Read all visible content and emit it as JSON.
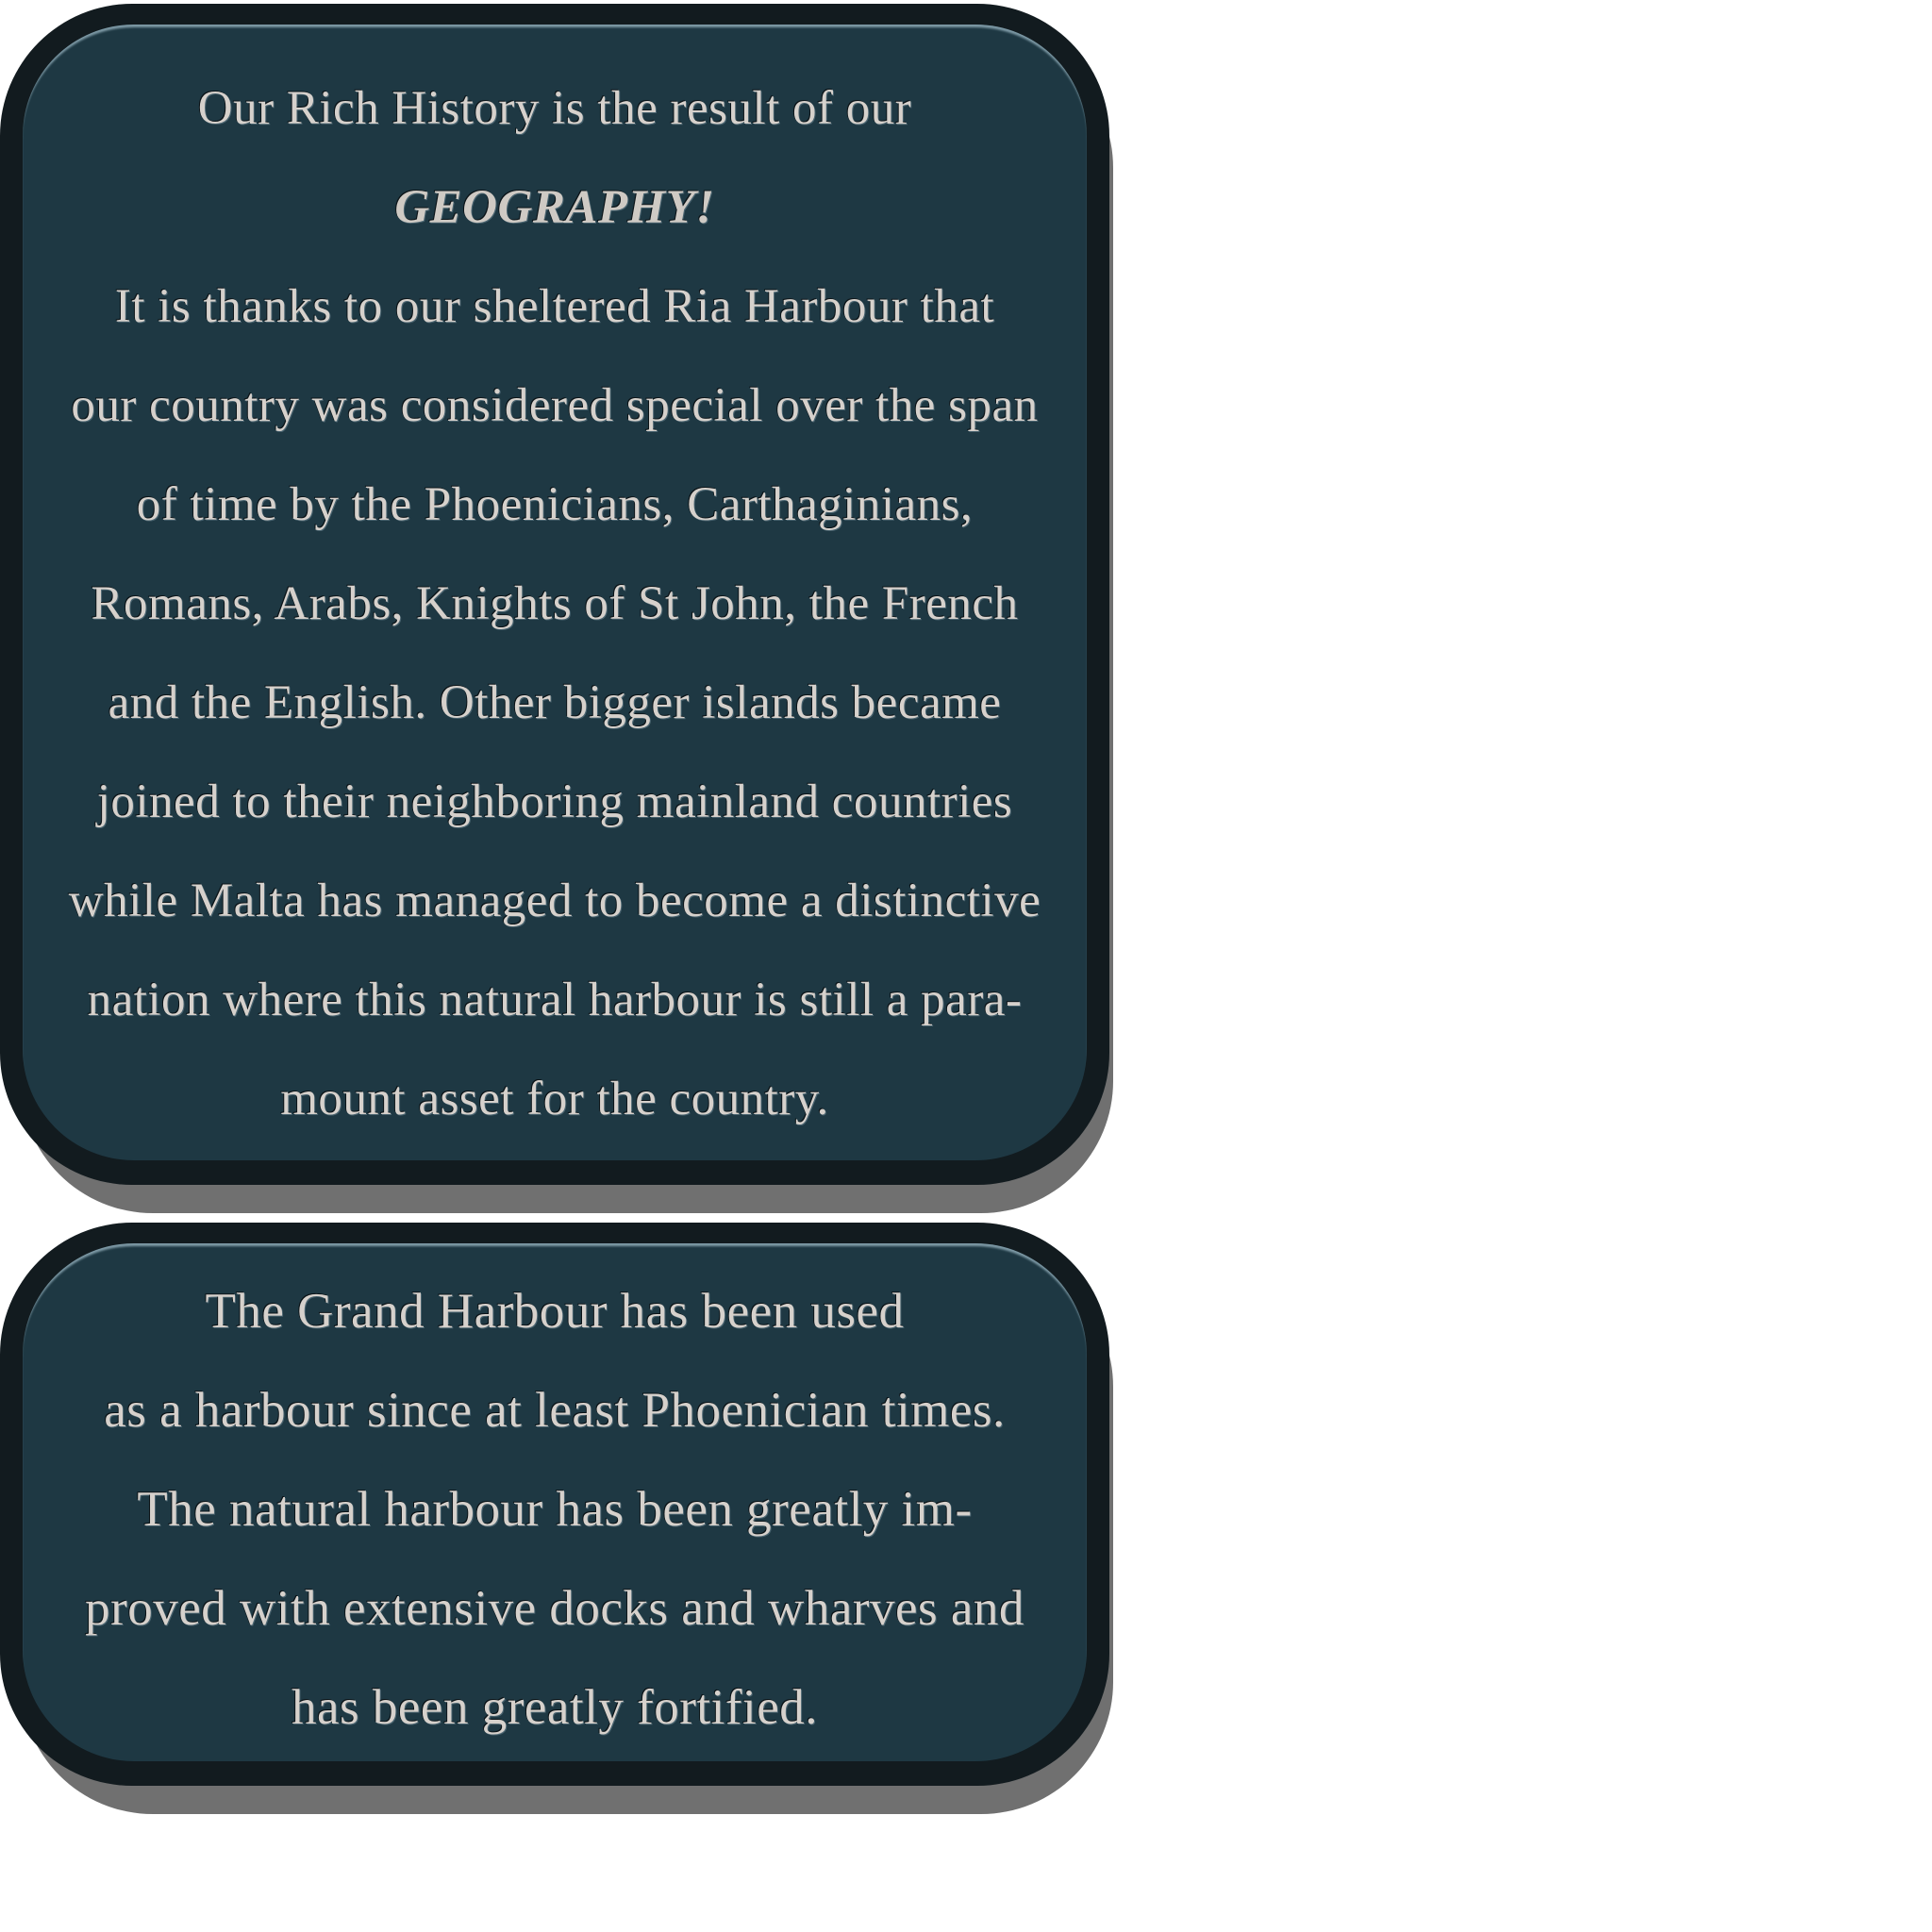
{
  "panel1": {
    "lines": [
      "Our Rich History is the result of  our",
      "GEOGRAPHY!",
      "It is thanks to our sheltered Ria Harbour that",
      "our country was considered special over the span",
      "of  time by the Phoenicians, Carthaginians,",
      "Romans, Arabs, Knights of  St John, the French",
      "and the English.  Other bigger islands became",
      "joined to their neighboring mainland countries",
      "while Malta has managed to become a distinctive",
      "nation where this natural harbour is still a para-",
      "mount asset for the country."
    ]
  },
  "panel2": {
    "lines": [
      "The Grand Harbour has been used",
      "as a harbour since at least Phoenician times.",
      "The natural harbour has been greatly im-",
      "proved with extensive docks and wharves and",
      "has been greatly fortified."
    ]
  }
}
